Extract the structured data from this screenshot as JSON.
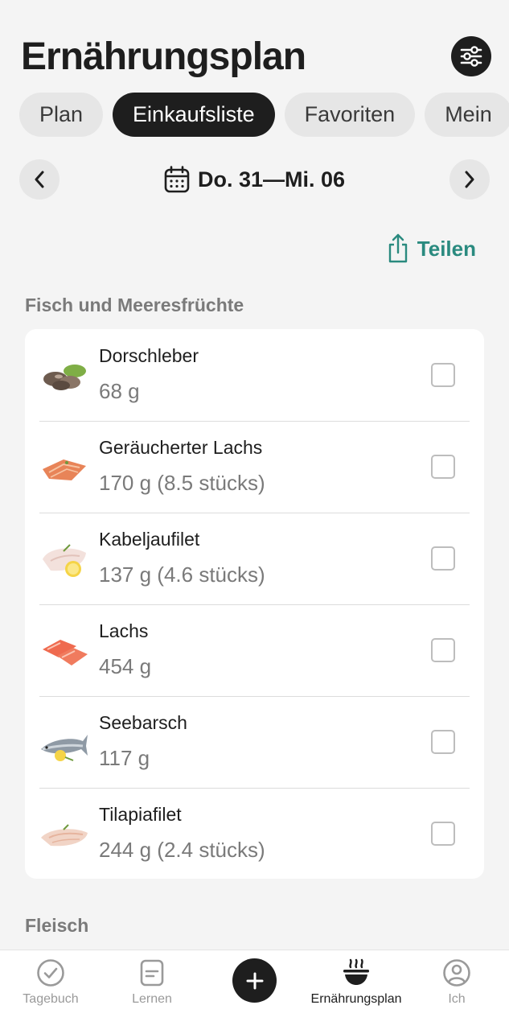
{
  "header": {
    "title": "Ernährungsplan",
    "settings_icon": "sliders-icon"
  },
  "tabs": [
    {
      "label": "Plan",
      "active": false
    },
    {
      "label": "Einkaufsliste",
      "active": true
    },
    {
      "label": "Favoriten",
      "active": false
    },
    {
      "label": "Mein",
      "active": false
    }
  ],
  "week": {
    "range": "Do. 31—Mi. 06"
  },
  "share": {
    "label": "Teilen"
  },
  "sections": [
    {
      "title": "Fisch und Meeresfrüchte",
      "items": [
        {
          "name": "Dorschleber",
          "qty": "68 g",
          "checked": false
        },
        {
          "name": "Geräucherter Lachs",
          "qty": "170 g (8.5 stücks)",
          "checked": false
        },
        {
          "name": "Kabeljaufilet",
          "qty": "137 g (4.6 stücks)",
          "checked": false
        },
        {
          "name": "Lachs",
          "qty": "454 g",
          "checked": false
        },
        {
          "name": "Seebarsch",
          "qty": "117 g",
          "checked": false
        },
        {
          "name": "Tilapiafilet",
          "qty": "244 g (2.4 stücks)",
          "checked": false
        }
      ]
    },
    {
      "title": "Fleisch",
      "items": []
    }
  ],
  "bottom_nav": [
    {
      "label": "Tagebuch",
      "icon": "check-circle-icon",
      "active": false
    },
    {
      "label": "Lernen",
      "icon": "notes-icon",
      "active": false
    },
    {
      "label": "Ernährungsplan",
      "icon": "food-bowl-icon",
      "active": true
    },
    {
      "label": "Ich",
      "icon": "profile-icon",
      "active": false
    }
  ],
  "colors": {
    "accent": "#2a8a7f",
    "dark": "#1e1e1e",
    "background": "#f4f4f4"
  }
}
